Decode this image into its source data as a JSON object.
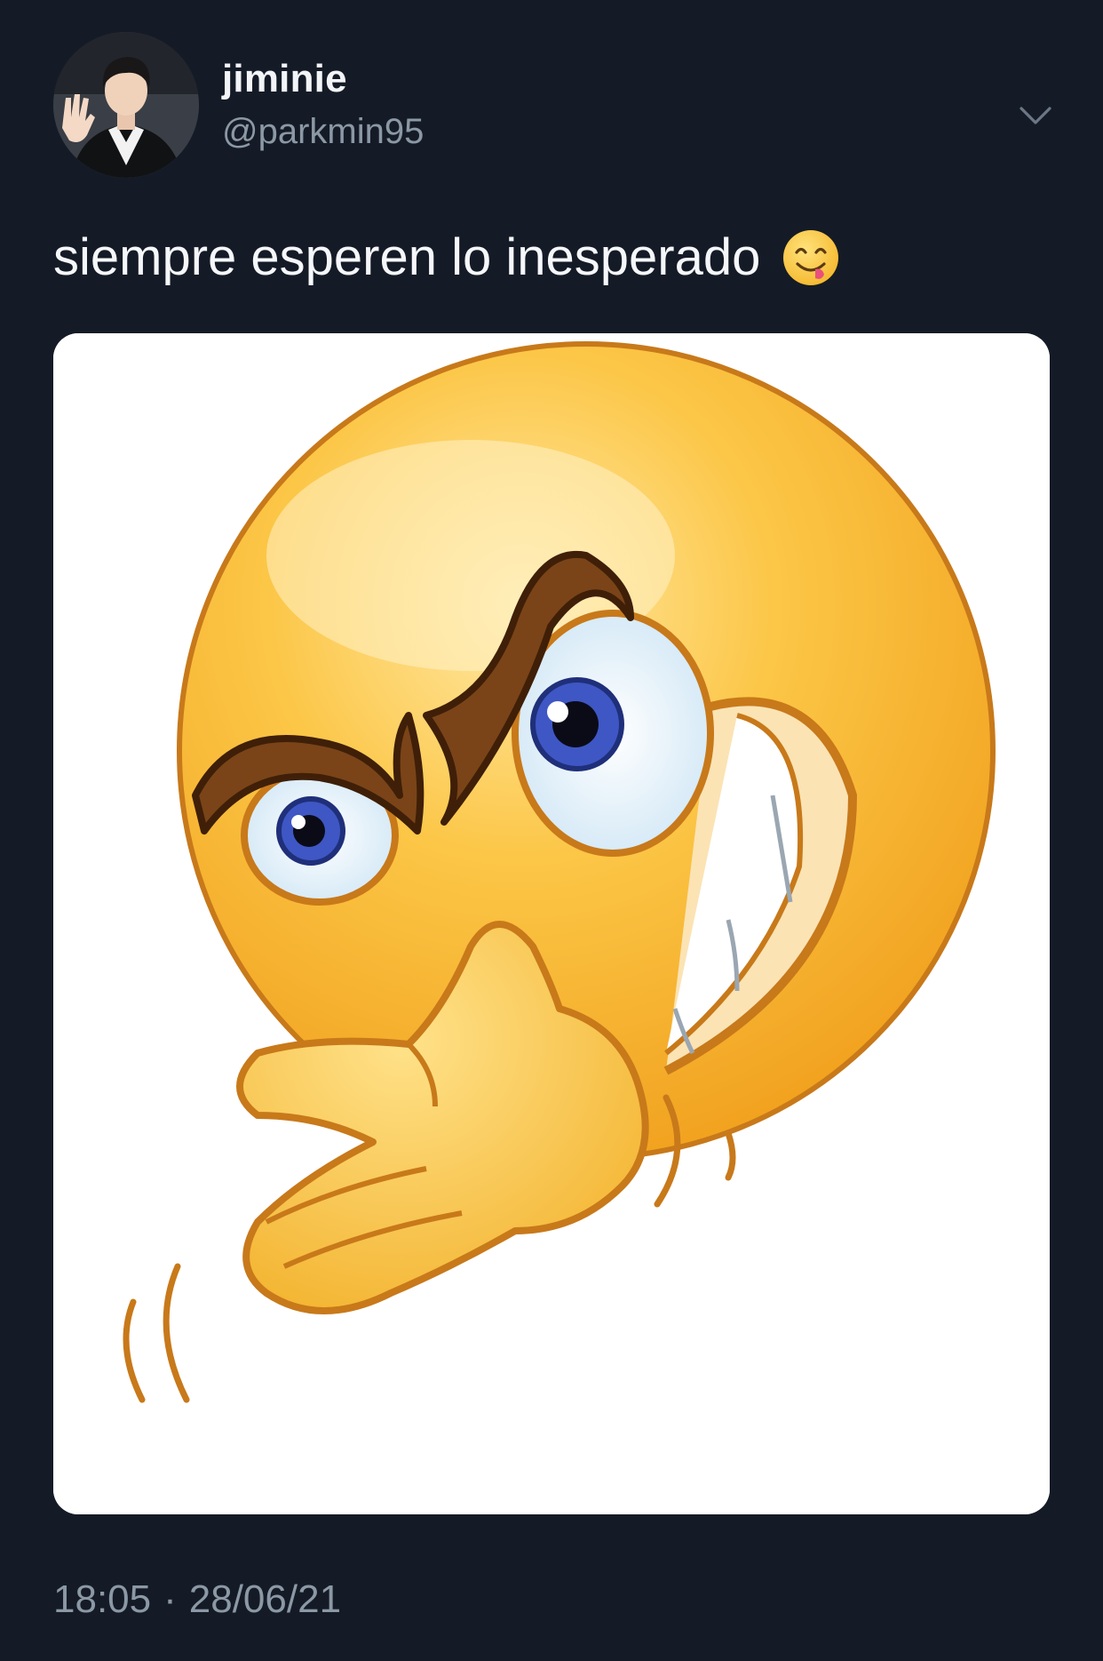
{
  "tweet": {
    "author": {
      "display_name": "jiminie",
      "handle": "@parkmin95"
    },
    "text": "siempre esperen lo inesperado",
    "text_emoji": "face-savoring-food-emoji",
    "media": {
      "subject": "smirking-emoji-with-hand-gesture"
    },
    "time": "18:05",
    "separator": "·",
    "date": "28/06/21"
  },
  "icons": {
    "menu": "chevron-down-icon"
  },
  "colors": {
    "background": "#151b26",
    "primary_text": "#f5f7fa",
    "secondary_text": "#8b98a5"
  }
}
